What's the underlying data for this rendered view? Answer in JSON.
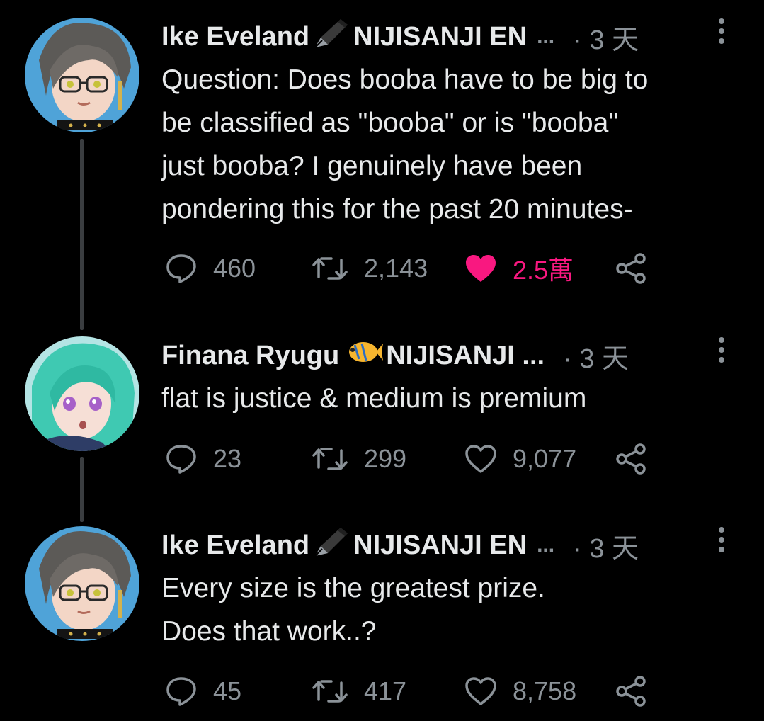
{
  "tweets": [
    {
      "author": "Ike Eveland",
      "author_suffix": "NIJISANJI EN",
      "name_icon": "fountain-pen-icon",
      "ellipsis": "...",
      "time": "· 3 天",
      "text": "Question: Does booba have to be big to\nbe classified as \"booba\" or is \"booba\"\njust booba? I genuinely have been\npondering this for the past 20 minutes-",
      "replies": "460",
      "retweets": "2,143",
      "likes": "2.5萬",
      "liked": true
    },
    {
      "author": "Finana Ryugu",
      "author_suffix": "NIJISANJI ...",
      "name_icon": "fish-icon",
      "ellipsis": "",
      "time": "· 3 天",
      "text": "flat is justice & medium is premium",
      "replies": "23",
      "retweets": "299",
      "likes": "9,077",
      "liked": false
    },
    {
      "author": "Ike Eveland",
      "author_suffix": "NIJISANJI EN",
      "name_icon": "fountain-pen-icon",
      "ellipsis": "...",
      "time": "· 3 天",
      "text": "Every size is the greatest prize.\nDoes that work..?",
      "replies": "45",
      "retweets": "417",
      "likes": "8,758",
      "liked": false
    }
  ],
  "colors": {
    "background": "#000000",
    "text": "#e7e9ea",
    "muted": "#8b9298",
    "like": "#f91880",
    "thread_line": "#3a3d40"
  }
}
